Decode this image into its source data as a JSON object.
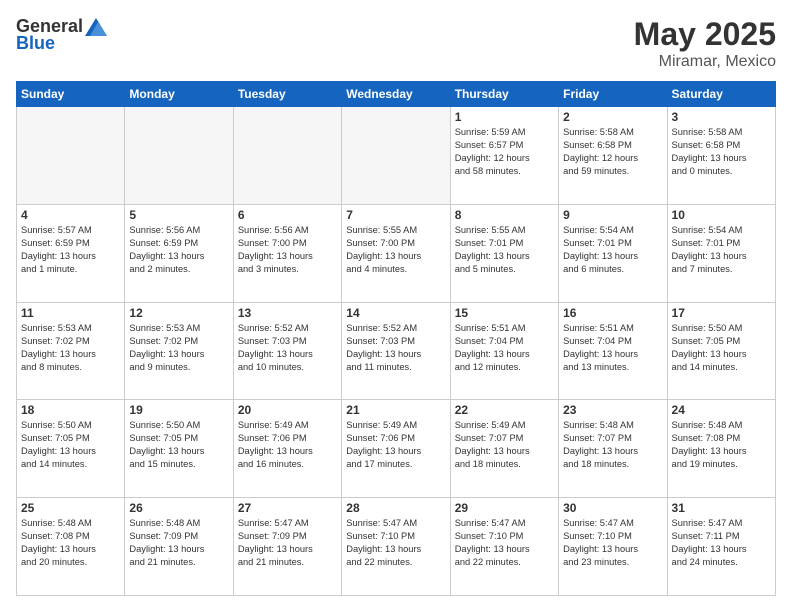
{
  "header": {
    "logo_general": "General",
    "logo_blue": "Blue",
    "title": "May 2025",
    "location": "Miramar, Mexico"
  },
  "weekdays": [
    "Sunday",
    "Monday",
    "Tuesday",
    "Wednesday",
    "Thursday",
    "Friday",
    "Saturday"
  ],
  "weeks": [
    [
      {
        "day": "",
        "empty": true
      },
      {
        "day": "",
        "empty": true
      },
      {
        "day": "",
        "empty": true
      },
      {
        "day": "",
        "empty": true
      },
      {
        "day": "1",
        "lines": [
          "Sunrise: 5:59 AM",
          "Sunset: 6:57 PM",
          "Daylight: 12 hours",
          "and 58 minutes."
        ]
      },
      {
        "day": "2",
        "lines": [
          "Sunrise: 5:58 AM",
          "Sunset: 6:58 PM",
          "Daylight: 12 hours",
          "and 59 minutes."
        ]
      },
      {
        "day": "3",
        "lines": [
          "Sunrise: 5:58 AM",
          "Sunset: 6:58 PM",
          "Daylight: 13 hours",
          "and 0 minutes."
        ]
      }
    ],
    [
      {
        "day": "4",
        "lines": [
          "Sunrise: 5:57 AM",
          "Sunset: 6:59 PM",
          "Daylight: 13 hours",
          "and 1 minute."
        ]
      },
      {
        "day": "5",
        "lines": [
          "Sunrise: 5:56 AM",
          "Sunset: 6:59 PM",
          "Daylight: 13 hours",
          "and 2 minutes."
        ]
      },
      {
        "day": "6",
        "lines": [
          "Sunrise: 5:56 AM",
          "Sunset: 7:00 PM",
          "Daylight: 13 hours",
          "and 3 minutes."
        ]
      },
      {
        "day": "7",
        "lines": [
          "Sunrise: 5:55 AM",
          "Sunset: 7:00 PM",
          "Daylight: 13 hours",
          "and 4 minutes."
        ]
      },
      {
        "day": "8",
        "lines": [
          "Sunrise: 5:55 AM",
          "Sunset: 7:01 PM",
          "Daylight: 13 hours",
          "and 5 minutes."
        ]
      },
      {
        "day": "9",
        "lines": [
          "Sunrise: 5:54 AM",
          "Sunset: 7:01 PM",
          "Daylight: 13 hours",
          "and 6 minutes."
        ]
      },
      {
        "day": "10",
        "lines": [
          "Sunrise: 5:54 AM",
          "Sunset: 7:01 PM",
          "Daylight: 13 hours",
          "and 7 minutes."
        ]
      }
    ],
    [
      {
        "day": "11",
        "lines": [
          "Sunrise: 5:53 AM",
          "Sunset: 7:02 PM",
          "Daylight: 13 hours",
          "and 8 minutes."
        ]
      },
      {
        "day": "12",
        "lines": [
          "Sunrise: 5:53 AM",
          "Sunset: 7:02 PM",
          "Daylight: 13 hours",
          "and 9 minutes."
        ]
      },
      {
        "day": "13",
        "lines": [
          "Sunrise: 5:52 AM",
          "Sunset: 7:03 PM",
          "Daylight: 13 hours",
          "and 10 minutes."
        ]
      },
      {
        "day": "14",
        "lines": [
          "Sunrise: 5:52 AM",
          "Sunset: 7:03 PM",
          "Daylight: 13 hours",
          "and 11 minutes."
        ]
      },
      {
        "day": "15",
        "lines": [
          "Sunrise: 5:51 AM",
          "Sunset: 7:04 PM",
          "Daylight: 13 hours",
          "and 12 minutes."
        ]
      },
      {
        "day": "16",
        "lines": [
          "Sunrise: 5:51 AM",
          "Sunset: 7:04 PM",
          "Daylight: 13 hours",
          "and 13 minutes."
        ]
      },
      {
        "day": "17",
        "lines": [
          "Sunrise: 5:50 AM",
          "Sunset: 7:05 PM",
          "Daylight: 13 hours",
          "and 14 minutes."
        ]
      }
    ],
    [
      {
        "day": "18",
        "lines": [
          "Sunrise: 5:50 AM",
          "Sunset: 7:05 PM",
          "Daylight: 13 hours",
          "and 14 minutes."
        ]
      },
      {
        "day": "19",
        "lines": [
          "Sunrise: 5:50 AM",
          "Sunset: 7:05 PM",
          "Daylight: 13 hours",
          "and 15 minutes."
        ]
      },
      {
        "day": "20",
        "lines": [
          "Sunrise: 5:49 AM",
          "Sunset: 7:06 PM",
          "Daylight: 13 hours",
          "and 16 minutes."
        ]
      },
      {
        "day": "21",
        "lines": [
          "Sunrise: 5:49 AM",
          "Sunset: 7:06 PM",
          "Daylight: 13 hours",
          "and 17 minutes."
        ]
      },
      {
        "day": "22",
        "lines": [
          "Sunrise: 5:49 AM",
          "Sunset: 7:07 PM",
          "Daylight: 13 hours",
          "and 18 minutes."
        ]
      },
      {
        "day": "23",
        "lines": [
          "Sunrise: 5:48 AM",
          "Sunset: 7:07 PM",
          "Daylight: 13 hours",
          "and 18 minutes."
        ]
      },
      {
        "day": "24",
        "lines": [
          "Sunrise: 5:48 AM",
          "Sunset: 7:08 PM",
          "Daylight: 13 hours",
          "and 19 minutes."
        ]
      }
    ],
    [
      {
        "day": "25",
        "lines": [
          "Sunrise: 5:48 AM",
          "Sunset: 7:08 PM",
          "Daylight: 13 hours",
          "and 20 minutes."
        ]
      },
      {
        "day": "26",
        "lines": [
          "Sunrise: 5:48 AM",
          "Sunset: 7:09 PM",
          "Daylight: 13 hours",
          "and 21 minutes."
        ]
      },
      {
        "day": "27",
        "lines": [
          "Sunrise: 5:47 AM",
          "Sunset: 7:09 PM",
          "Daylight: 13 hours",
          "and 21 minutes."
        ]
      },
      {
        "day": "28",
        "lines": [
          "Sunrise: 5:47 AM",
          "Sunset: 7:10 PM",
          "Daylight: 13 hours",
          "and 22 minutes."
        ]
      },
      {
        "day": "29",
        "lines": [
          "Sunrise: 5:47 AM",
          "Sunset: 7:10 PM",
          "Daylight: 13 hours",
          "and 22 minutes."
        ]
      },
      {
        "day": "30",
        "lines": [
          "Sunrise: 5:47 AM",
          "Sunset: 7:10 PM",
          "Daylight: 13 hours",
          "and 23 minutes."
        ]
      },
      {
        "day": "31",
        "lines": [
          "Sunrise: 5:47 AM",
          "Sunset: 7:11 PM",
          "Daylight: 13 hours",
          "and 24 minutes."
        ]
      }
    ]
  ]
}
